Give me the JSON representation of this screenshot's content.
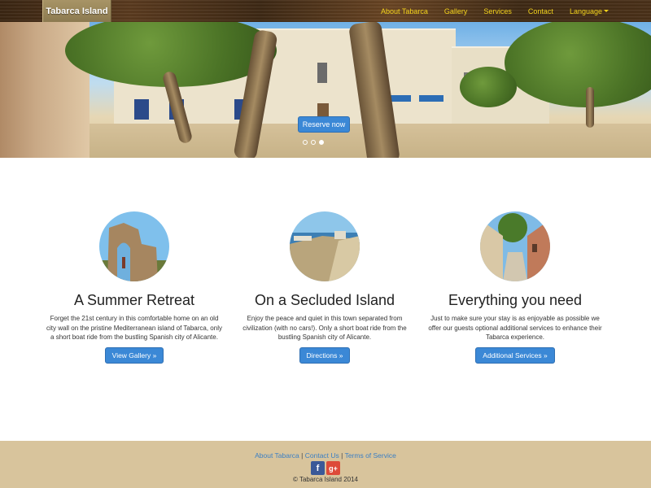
{
  "navbar": {
    "brand": "Tabarca Island",
    "links": [
      "About Tabarca",
      "Gallery",
      "Services",
      "Contact"
    ],
    "language": "Language"
  },
  "hero": {
    "reserve_label": "Reserve now",
    "carousel_indicators": 3,
    "active_indicator": 2
  },
  "features": [
    {
      "title": "A Summer Retreat",
      "text": "Forget the 21st century in this comfortable home on an old city wall on the pristine Mediterranean island of Tabarca, only a short boat ride from the bustling Spanish city of Alicante.",
      "button": "View Gallery »"
    },
    {
      "title": "On a Secluded Island",
      "text": "Enjoy the peace and quiet in this town separated from civilization (with no cars!). Only a short boat ride from the bustling Spanish city of Alicante.",
      "button": "Directions »"
    },
    {
      "title": "Everything you need",
      "text": "Just to make sure your stay is as enjoyable as possible we offer our guests optional additional services to enhance their Tabarca experience.",
      "button": "Additional Services »"
    }
  ],
  "footer": {
    "links": [
      "About Tabarca",
      "Contact Us",
      "Terms of Service"
    ],
    "separator": " | ",
    "facebook_glyph": "f",
    "googleplus_glyph": "g+",
    "copyright": "© Tabarca Island 2014"
  },
  "colors": {
    "nav_link": "#f3d31c",
    "button_blue": "#3b88d6",
    "footer_bg": "#d8c49c",
    "link_blue": "#3b7fc4"
  }
}
